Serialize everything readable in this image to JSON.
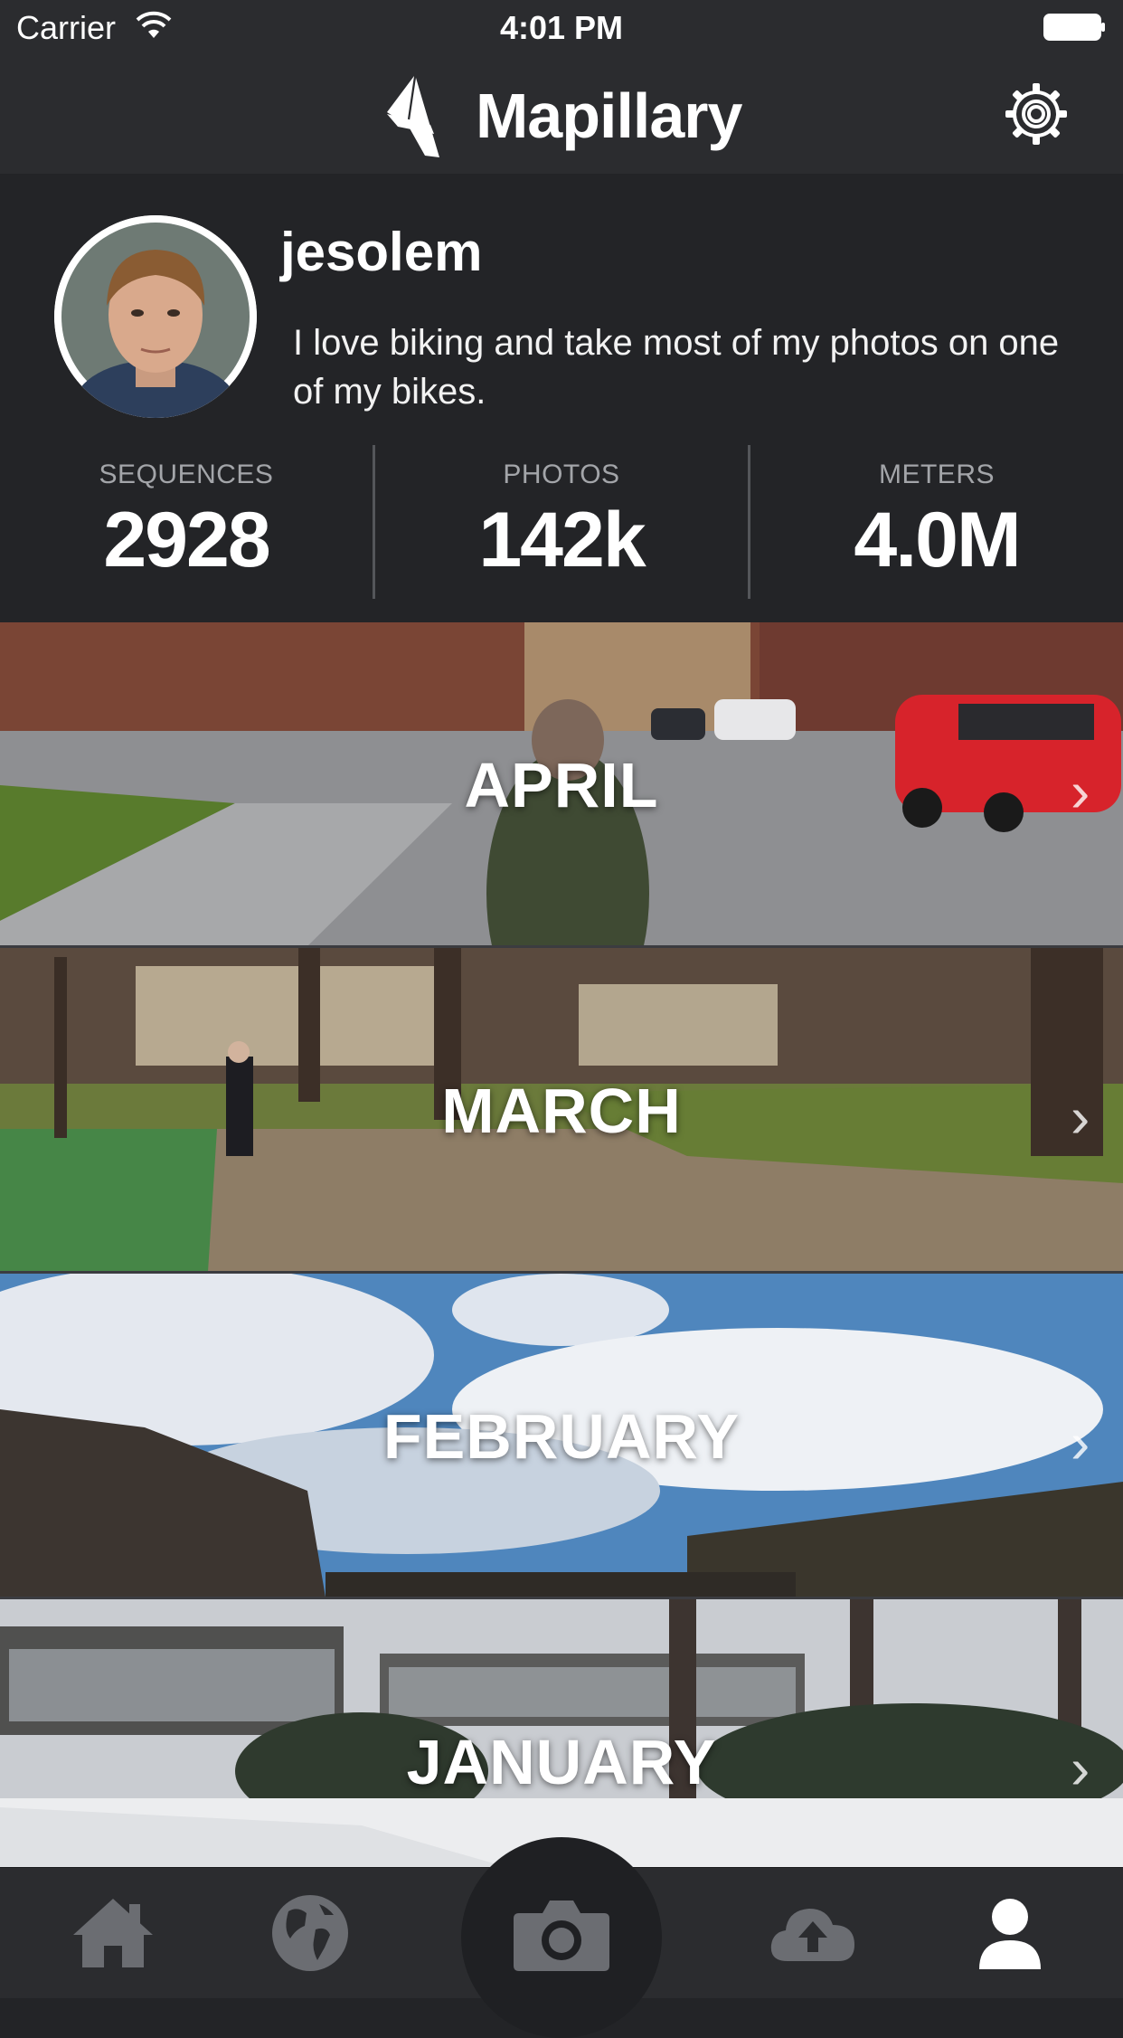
{
  "status_bar": {
    "carrier": "Carrier",
    "time": "4:01 PM"
  },
  "nav": {
    "brand": "Mapillary",
    "settings_icon": "gear-icon"
  },
  "profile": {
    "username": "jesolem",
    "bio": "I love biking and take most of my photos on one of my bikes."
  },
  "stats": [
    {
      "label": "SEQUENCES",
      "value": "2928"
    },
    {
      "label": "PHOTOS",
      "value": "142k"
    },
    {
      "label": "METERS",
      "value": "4.0M"
    }
  ],
  "months": [
    {
      "label": "APRIL"
    },
    {
      "label": "MARCH"
    },
    {
      "label": "FEBRUARY"
    },
    {
      "label": "JANUARY"
    }
  ],
  "tabs": [
    {
      "icon": "home-icon"
    },
    {
      "icon": "globe-icon"
    },
    {
      "icon": "camera-icon"
    },
    {
      "icon": "cloud-upload-icon"
    },
    {
      "icon": "profile-icon"
    }
  ],
  "colors": {
    "background": "#232427",
    "bar": "#2b2c2f",
    "active_tab": "#ffffff",
    "inactive_tab": "#6b6d72"
  }
}
